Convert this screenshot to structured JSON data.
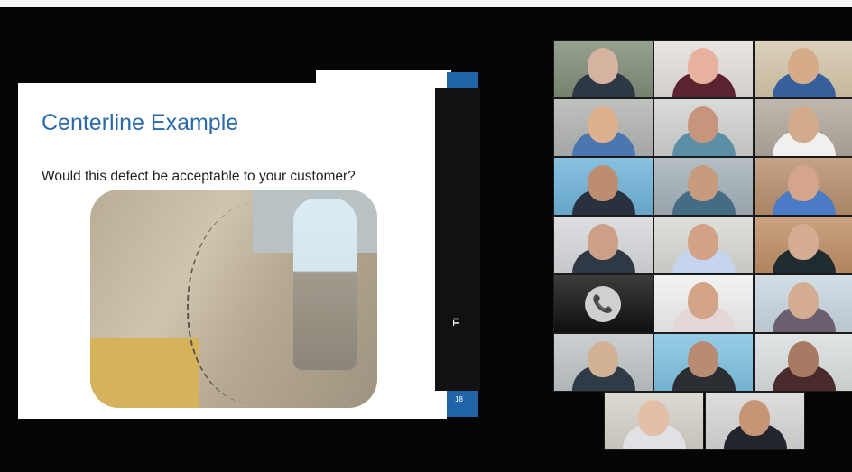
{
  "slide": {
    "title": "Centerline Example",
    "subtitle": "Would this defect be acceptable to your customer?",
    "vertical_label": "TI",
    "page_number": "18"
  },
  "call": {
    "phone_icon": "phone-icon",
    "tiles": [
      {
        "kind": "person",
        "bg": "#7f8d77",
        "shirt": "#2e3744",
        "head": "#d6b2a0"
      },
      {
        "kind": "person",
        "bg": "#e3e0dc",
        "shirt": "#5b2230",
        "head": "#e7b19d"
      },
      {
        "kind": "person",
        "bg": "#d4c7aa",
        "shirt": "#365f9b",
        "head": "#d6ab8a"
      },
      {
        "kind": "person",
        "bg": "#b1b4b2",
        "shirt": "#4c76b0",
        "head": "#ddb08e"
      },
      {
        "kind": "person",
        "bg": "#d1d3d0",
        "shirt": "#5c8ea6",
        "head": "#c7957d"
      },
      {
        "kind": "person",
        "bg": "#b2a89e",
        "shirt": "#f0f0ee",
        "head": "#d1ab8b"
      },
      {
        "kind": "person",
        "bg": "#6fb3d9",
        "shirt": "#29313f",
        "head": "#bc8d6e"
      },
      {
        "kind": "person",
        "bg": "#a4b0b8",
        "shirt": "#446d85",
        "head": "#c79c7e"
      },
      {
        "kind": "person",
        "bg": "#b88f6d",
        "shirt": "#4b7bc4",
        "head": "#d4a48b"
      },
      {
        "kind": "person",
        "bg": "#d7d8db",
        "shirt": "#2f3946",
        "head": "#cc9f87"
      },
      {
        "kind": "person",
        "bg": "#d9d8d3",
        "shirt": "#c5d4ef",
        "head": "#d1a286"
      },
      {
        "kind": "person",
        "bg": "#bf8f66",
        "shirt": "#202b30",
        "head": "#d3ac92"
      },
      {
        "kind": "phone",
        "bg": "#111111"
      },
      {
        "kind": "person",
        "bg": "#f0f0ef",
        "shirt": "#e5d7d7",
        "head": "#d4a487"
      },
      {
        "kind": "person",
        "bg": "#c9d7e0",
        "shirt": "#6b5e6e",
        "head": "#d4ac92"
      },
      {
        "kind": "person",
        "bg": "#bfc5c8",
        "shirt": "#2f3b47",
        "head": "#d2b194"
      },
      {
        "kind": "person",
        "bg": "#7fc2e1",
        "shirt": "#2b2f34",
        "head": "#b88b73"
      },
      {
        "kind": "person",
        "bg": "#dbdedf",
        "shirt": "#4a2b2c",
        "head": "#a77a64"
      },
      {
        "kind": "person",
        "bg": "#d6d2c9",
        "shirt": "#dfe1e5",
        "head": "#e4bfa8"
      },
      {
        "kind": "person",
        "bg": "#d8d7d5",
        "shirt": "#22252d",
        "head": "#c79575"
      }
    ]
  }
}
